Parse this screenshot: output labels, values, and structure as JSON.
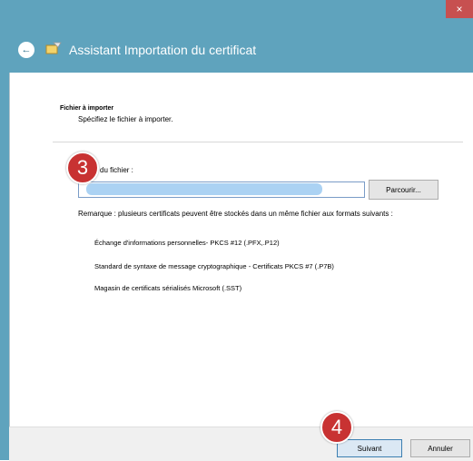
{
  "window": {
    "title": "Assistant Importation du certificat",
    "close_glyph": "×",
    "back_glyph": "←",
    "accent": "#5fa3bd"
  },
  "section": {
    "title": "Fichier à importer",
    "subtitle": "Spécifiez le fichier à importer."
  },
  "file_field": {
    "label": "du fichier :",
    "value": "",
    "browse_label": "Parcourir..."
  },
  "remark": "Remarque : plusieurs certificats peuvent être stockés dans un même fichier aux formats suivants :",
  "formats": [
    "Échange d'informations personnelles- PKCS #12 (.PFX,.P12)",
    "Standard de syntaxe de message cryptographique - Certificats PKCS #7 (.P7B)",
    "Magasin de certificats sérialisés Microsoft (.SST)"
  ],
  "buttons": {
    "next": "Suivant",
    "cancel": "Annuler"
  },
  "annotations": {
    "step_3": "3",
    "step_4": "4",
    "color": "#c83232"
  }
}
